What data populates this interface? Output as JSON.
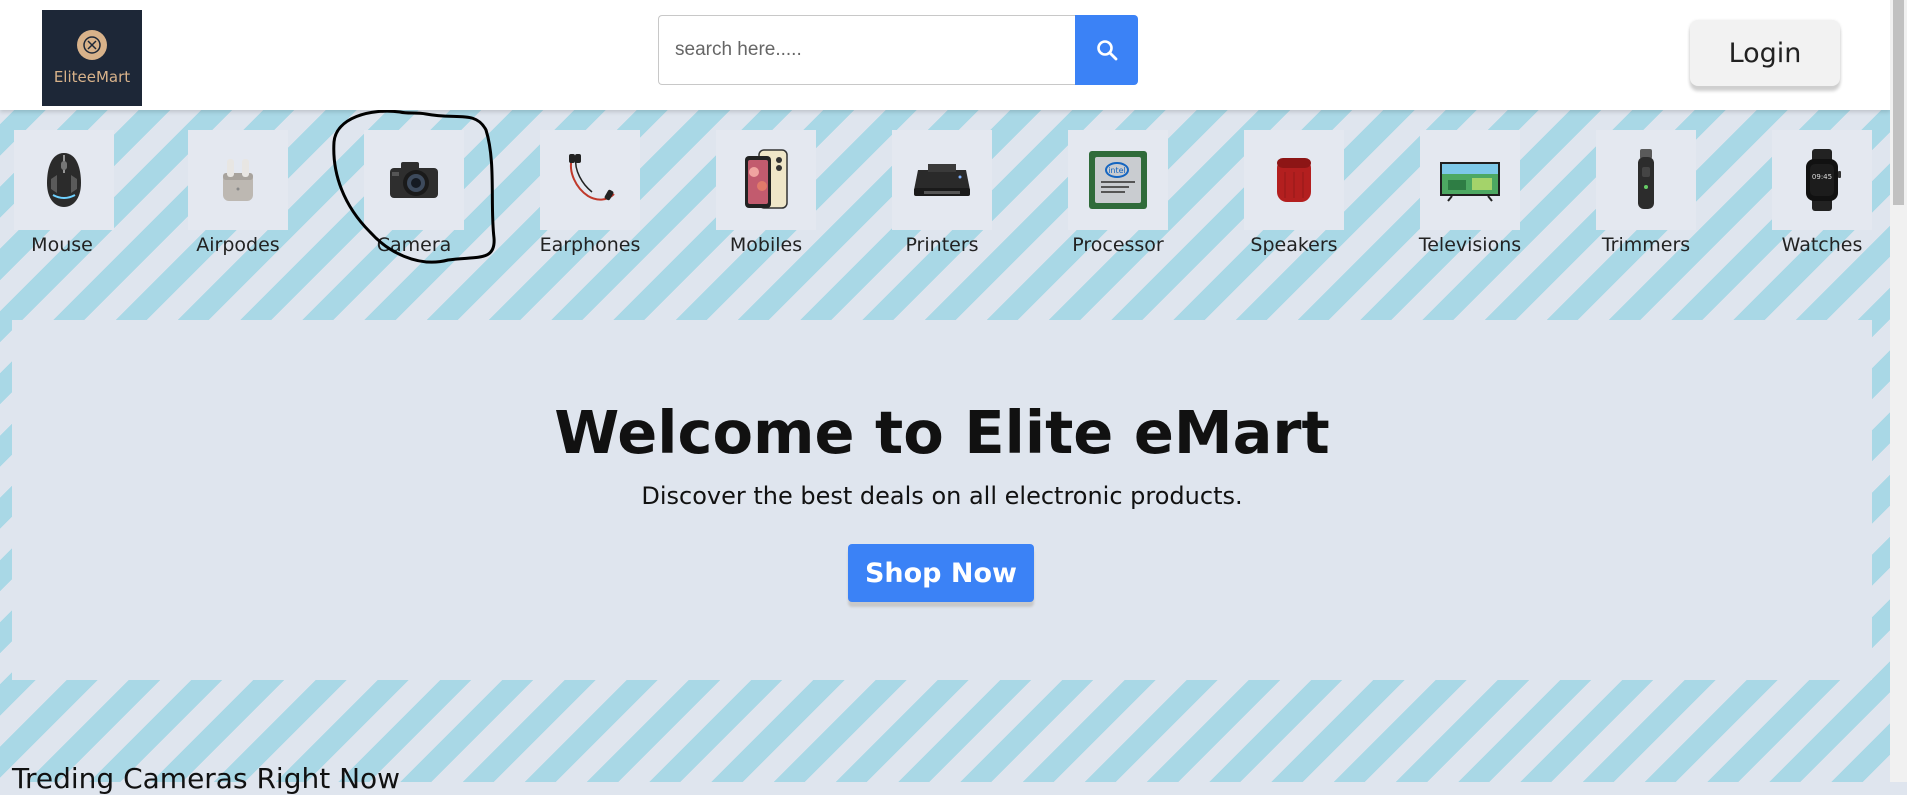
{
  "header": {
    "logo_text": "EliteeMart",
    "search_placeholder": "search here.....",
    "login_label": "Login"
  },
  "categories": [
    {
      "label": "Mouse",
      "icon": "mouse-icon"
    },
    {
      "label": "Airpodes",
      "icon": "airpods-icon"
    },
    {
      "label": "Camera",
      "icon": "camera-icon"
    },
    {
      "label": "Earphones",
      "icon": "earphones-icon"
    },
    {
      "label": "Mobiles",
      "icon": "mobile-icon"
    },
    {
      "label": "Printers",
      "icon": "printer-icon"
    },
    {
      "label": "Processor",
      "icon": "processor-icon"
    },
    {
      "label": "Speakers",
      "icon": "speaker-icon"
    },
    {
      "label": "Televisions",
      "icon": "television-icon"
    },
    {
      "label": "Trimmers",
      "icon": "trimmer-icon"
    },
    {
      "label": "Watches",
      "icon": "watch-icon"
    }
  ],
  "hero": {
    "title": "Welcome to Elite eMart",
    "subtitle": "Discover the best deals on all electronic products.",
    "button_label": "Shop Now"
  },
  "section": {
    "title": "Treding Cameras Right Now"
  },
  "colors": {
    "accent": "#3b82f6",
    "stripe": "#a9d8e6",
    "background": "#dfe5ee",
    "logo_bg": "#1d2737",
    "logo_gold": "#d8b28a"
  }
}
